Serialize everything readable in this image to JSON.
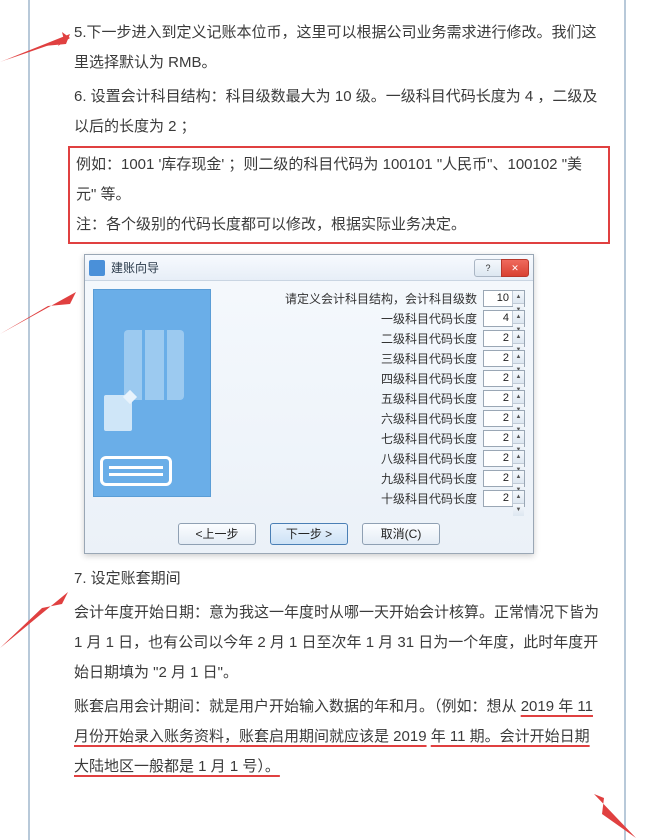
{
  "paragraphs": {
    "p5": "5.下一步进入到定义记账本位币，这里可以根据公司业务需求进行修改。我们这里选择默认为 RMB。",
    "p6": "6. 设置会计科目结构：科目级数最大为 10 级。一级科目代码长度为 4 ，二级及以后的长度为 2 ；",
    "example": "例如：1001 '库存现金' ；则二级的科目代码为 100101 \"人民币\"、100102 \"美元\" 等。",
    "note": "注：各个级别的代码长度都可以修改，根据实际业务决定。",
    "p7_title": "7.  设定账套期间",
    "p7_a": "会计年度开始日期：意为我这一年度时从哪一天开始会计核算。正常情况下皆为 1 月 1 日，也有公司以今年 2 月 1 日至次年 1 月 31 日为一个年度，此时年度开始日期填为 \"2 月 1 日\"。",
    "p7_b_pre": "账套启用会计期间：就是用户开始输入数据的年和月。（例如：想从",
    "p7_b_u1": "2019 年 11 月份开始录入账务资料，账套启用期间就应该是 2019",
    "p7_b_u2": "年 11 期。会计开始日期大陆地区一般都是 1 月 1 号）。"
  },
  "dialog": {
    "title": "建账向导",
    "help": "?",
    "close": "✕",
    "header_label": "请定义会计科目结构，会计科目级数",
    "levels": [
      {
        "label": "一级科目代码长度",
        "value": "4"
      },
      {
        "label": "二级科目代码长度",
        "value": "2"
      },
      {
        "label": "三级科目代码长度",
        "value": "2"
      },
      {
        "label": "四级科目代码长度",
        "value": "2"
      },
      {
        "label": "五级科目代码长度",
        "value": "2"
      },
      {
        "label": "六级科目代码长度",
        "value": "2"
      },
      {
        "label": "七级科目代码长度",
        "value": "2"
      },
      {
        "label": "八级科目代码长度",
        "value": "2"
      },
      {
        "label": "九级科目代码长度",
        "value": "2"
      },
      {
        "label": "十级科目代码长度",
        "value": "2"
      }
    ],
    "level_count": "10",
    "buttons": {
      "prev": "<上一步",
      "next": "下一步 >",
      "cancel": "取消(C)"
    }
  }
}
